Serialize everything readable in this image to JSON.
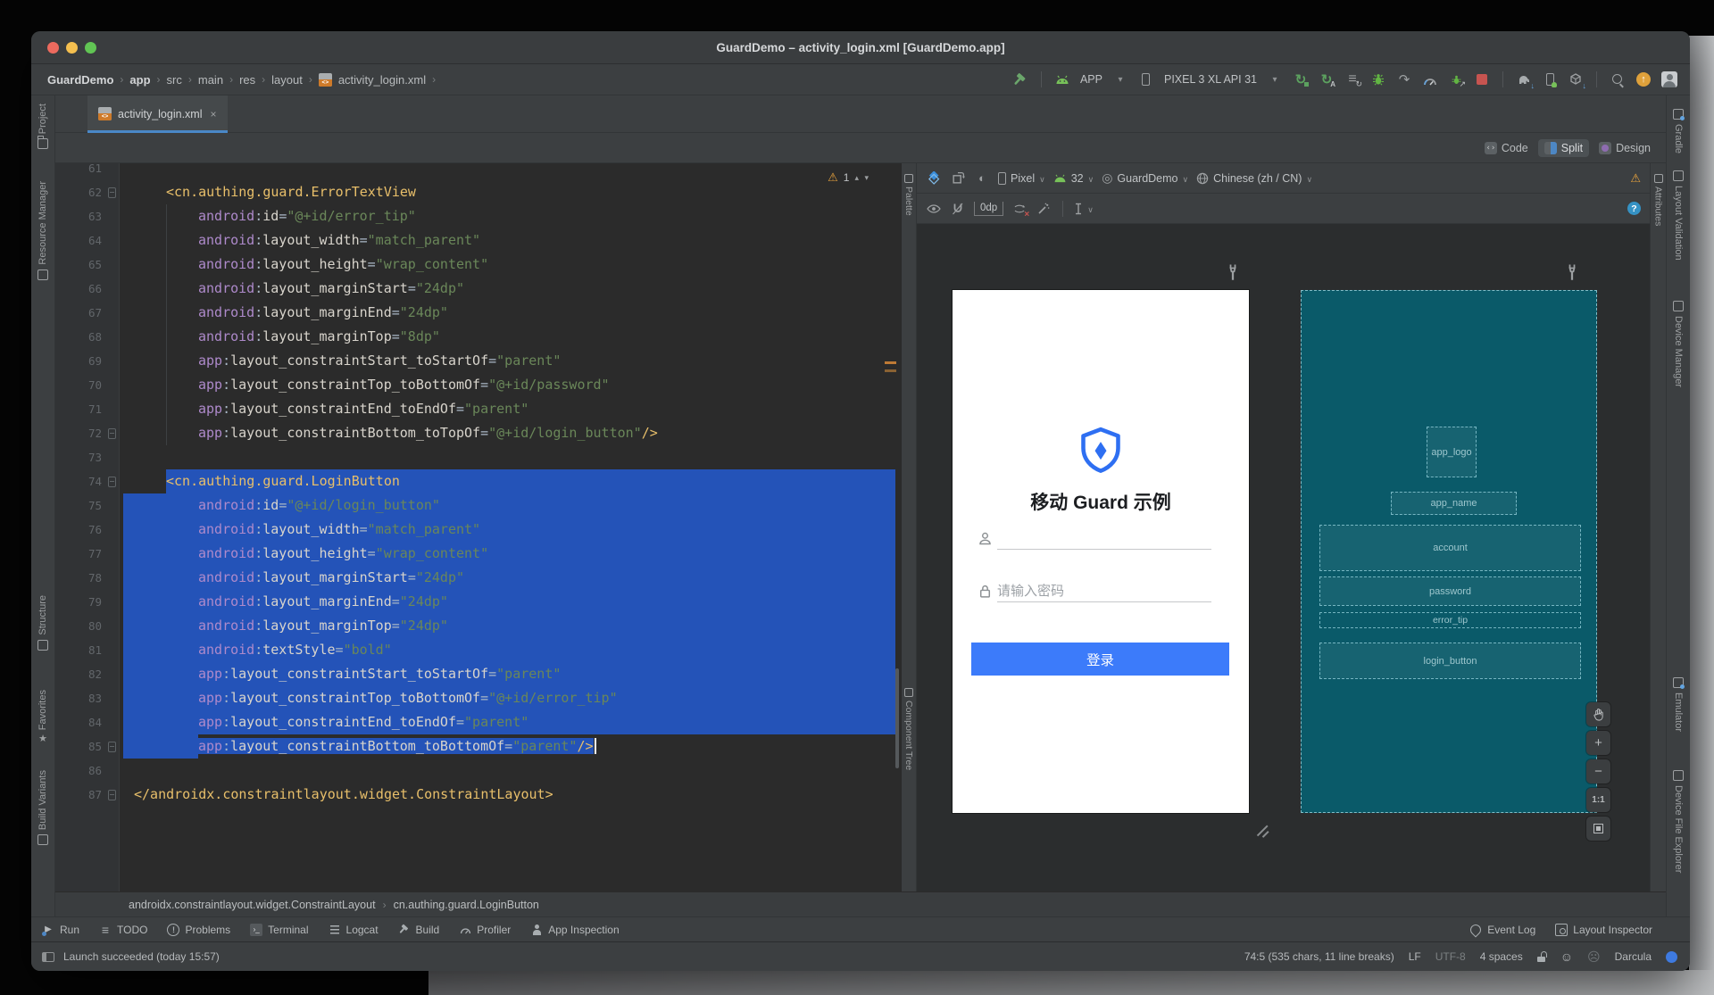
{
  "window": {
    "title": "GuardDemo – activity_login.xml [GuardDemo.app]"
  },
  "nav": {
    "breadcrumbs": [
      "GuardDemo",
      "app",
      "src",
      "main",
      "res",
      "layout",
      "activity_login.xml"
    ]
  },
  "run": {
    "config": "APP",
    "device": "PIXEL 3 XL API 31"
  },
  "tabs": {
    "active": "activity_login.xml",
    "close": "×"
  },
  "view": {
    "code": "Code",
    "split": "Split",
    "design": "Design"
  },
  "stripes": {
    "left": [
      "Project",
      "Resource Manager",
      "Structure",
      "Favorites",
      "Build Variants"
    ],
    "right": [
      "Gradle",
      "Layout Validation",
      "Device Manager",
      "Emulator",
      "Device File Explorer"
    ]
  },
  "editor": {
    "warning_count": "1",
    "lines": [
      {
        "n": 61,
        "i": 0,
        "tok": []
      },
      {
        "n": 62,
        "i": 4,
        "fold": 1,
        "tok": [
          [
            "t",
            "<cn.authing.guard.ErrorTextView"
          ]
        ]
      },
      {
        "n": 63,
        "i": 8,
        "tok": [
          [
            "n",
            "android"
          ],
          [
            "p",
            ":"
          ],
          [
            "a",
            "id"
          ],
          [
            "p",
            "="
          ],
          [
            "v",
            "\"@+id/error_tip\""
          ]
        ]
      },
      {
        "n": 64,
        "i": 8,
        "tok": [
          [
            "n",
            "android"
          ],
          [
            "p",
            ":"
          ],
          [
            "a",
            "layout_width"
          ],
          [
            "p",
            "="
          ],
          [
            "v",
            "\"match_parent\""
          ]
        ]
      },
      {
        "n": 65,
        "i": 8,
        "tok": [
          [
            "n",
            "android"
          ],
          [
            "p",
            ":"
          ],
          [
            "a",
            "layout_height"
          ],
          [
            "p",
            "="
          ],
          [
            "v",
            "\"wrap_content\""
          ]
        ]
      },
      {
        "n": 66,
        "i": 8,
        "tok": [
          [
            "n",
            "android"
          ],
          [
            "p",
            ":"
          ],
          [
            "a",
            "layout_marginStart"
          ],
          [
            "p",
            "="
          ],
          [
            "v",
            "\"24dp\""
          ]
        ]
      },
      {
        "n": 67,
        "i": 8,
        "tok": [
          [
            "n",
            "android"
          ],
          [
            "p",
            ":"
          ],
          [
            "a",
            "layout_marginEnd"
          ],
          [
            "p",
            "="
          ],
          [
            "v",
            "\"24dp\""
          ]
        ]
      },
      {
        "n": 68,
        "i": 8,
        "tok": [
          [
            "n",
            "android"
          ],
          [
            "p",
            ":"
          ],
          [
            "a",
            "layout_marginTop"
          ],
          [
            "p",
            "="
          ],
          [
            "v",
            "\"8dp\""
          ]
        ]
      },
      {
        "n": 69,
        "i": 8,
        "tok": [
          [
            "n",
            "app"
          ],
          [
            "p",
            ":"
          ],
          [
            "a",
            "layout_constraintStart_toStartOf"
          ],
          [
            "p",
            "="
          ],
          [
            "v",
            "\"parent\""
          ]
        ]
      },
      {
        "n": 70,
        "i": 8,
        "tok": [
          [
            "n",
            "app"
          ],
          [
            "p",
            ":"
          ],
          [
            "a",
            "layout_constraintTop_toBottomOf"
          ],
          [
            "p",
            "="
          ],
          [
            "v",
            "\"@+id/password\""
          ]
        ]
      },
      {
        "n": 71,
        "i": 8,
        "tok": [
          [
            "n",
            "app"
          ],
          [
            "p",
            ":"
          ],
          [
            "a",
            "layout_constraintEnd_toEndOf"
          ],
          [
            "p",
            "="
          ],
          [
            "v",
            "\"parent\""
          ]
        ]
      },
      {
        "n": 72,
        "i": 8,
        "fold": 1,
        "tok": [
          [
            "n",
            "app"
          ],
          [
            "p",
            ":"
          ],
          [
            "a",
            "layout_constraintBottom_toTopOf"
          ],
          [
            "p",
            "="
          ],
          [
            "v",
            "\"@+id/login_button\""
          ],
          [
            "t",
            "/>"
          ]
        ]
      },
      {
        "n": 73,
        "i": 0,
        "tok": []
      },
      {
        "n": 74,
        "i": 4,
        "fold": 1,
        "sel": "start",
        "tok": [
          [
            "t",
            "<cn.authing.guard.LoginButton"
          ]
        ]
      },
      {
        "n": 75,
        "i": 8,
        "sel": "full",
        "tok": [
          [
            "n",
            "android"
          ],
          [
            "p",
            ":"
          ],
          [
            "a",
            "id"
          ],
          [
            "p",
            "="
          ],
          [
            "v",
            "\"@+id/login_button\""
          ]
        ]
      },
      {
        "n": 76,
        "i": 8,
        "sel": "full",
        "tok": [
          [
            "n",
            "android"
          ],
          [
            "p",
            ":"
          ],
          [
            "a",
            "layout_width"
          ],
          [
            "p",
            "="
          ],
          [
            "v",
            "\"match_parent\""
          ]
        ]
      },
      {
        "n": 77,
        "i": 8,
        "sel": "full",
        "tok": [
          [
            "n",
            "android"
          ],
          [
            "p",
            ":"
          ],
          [
            "a",
            "layout_height"
          ],
          [
            "p",
            "="
          ],
          [
            "v",
            "\"wrap_content\""
          ]
        ]
      },
      {
        "n": 78,
        "i": 8,
        "sel": "full",
        "tok": [
          [
            "n",
            "android"
          ],
          [
            "p",
            ":"
          ],
          [
            "a",
            "layout_marginStart"
          ],
          [
            "p",
            "="
          ],
          [
            "v",
            "\"24dp\""
          ]
        ]
      },
      {
        "n": 79,
        "i": 8,
        "sel": "full",
        "tok": [
          [
            "n",
            "android"
          ],
          [
            "p",
            ":"
          ],
          [
            "a",
            "layout_marginEnd"
          ],
          [
            "p",
            "="
          ],
          [
            "v",
            "\"24dp\""
          ]
        ]
      },
      {
        "n": 80,
        "i": 8,
        "sel": "full",
        "tok": [
          [
            "n",
            "android"
          ],
          [
            "p",
            ":"
          ],
          [
            "a",
            "layout_marginTop"
          ],
          [
            "p",
            "="
          ],
          [
            "v",
            "\"24dp\""
          ]
        ]
      },
      {
        "n": 81,
        "i": 8,
        "sel": "full",
        "tok": [
          [
            "n",
            "android"
          ],
          [
            "p",
            ":"
          ],
          [
            "a",
            "textStyle"
          ],
          [
            "p",
            "="
          ],
          [
            "v",
            "\"bold\""
          ]
        ]
      },
      {
        "n": 82,
        "i": 8,
        "sel": "full",
        "tok": [
          [
            "n",
            "app"
          ],
          [
            "p",
            ":"
          ],
          [
            "a",
            "layout_constraintStart_toStartOf"
          ],
          [
            "p",
            "="
          ],
          [
            "v",
            "\"parent\""
          ]
        ]
      },
      {
        "n": 83,
        "i": 8,
        "sel": "full",
        "tok": [
          [
            "n",
            "app"
          ],
          [
            "p",
            ":"
          ],
          [
            "a",
            "layout_constraintTop_toBottomOf"
          ],
          [
            "p",
            "="
          ],
          [
            "v",
            "\"@+id/error_tip\""
          ]
        ]
      },
      {
        "n": 84,
        "i": 8,
        "sel": "full",
        "tok": [
          [
            "n",
            "app"
          ],
          [
            "p",
            ":"
          ],
          [
            "a",
            "layout_constraintEnd_toEndOf"
          ],
          [
            "p",
            "="
          ],
          [
            "v",
            "\"parent\""
          ]
        ]
      },
      {
        "n": 85,
        "i": 8,
        "fold": 1,
        "sel": "end",
        "caret": 1,
        "tok": [
          [
            "n",
            "app"
          ],
          [
            "p",
            ":"
          ],
          [
            "a",
            "layout_constraintBottom_toBottomOf"
          ],
          [
            "p",
            "="
          ],
          [
            "v",
            "\"parent\""
          ],
          [
            "t",
            "/>"
          ]
        ]
      },
      {
        "n": 86,
        "i": 0,
        "tok": []
      },
      {
        "n": 87,
        "i": 0,
        "fold": 1,
        "tok": [
          [
            "t",
            "</androidx.constraintlayout.widget.ConstraintLayout>"
          ]
        ]
      }
    ]
  },
  "design": {
    "device": "Pixel",
    "api": "32",
    "theme": "GuardDemo",
    "locale": "Chinese (zh / CN)",
    "margin": "0dp",
    "help": "?",
    "palette": "Palette",
    "component_tree": "Component Tree",
    "attributes": "Attributes",
    "zoom_in": "+",
    "zoom_out": "−",
    "zoom_ratio": "1:1",
    "preview": {
      "title": "移动 Guard 示例",
      "password_placeholder": "请输入密码",
      "login": "登录"
    },
    "blueprint": [
      "app_logo",
      "app_name",
      "account",
      "password",
      "error_tip",
      "login_button"
    ]
  },
  "xmlcrumb": [
    "androidx.constraintlayout.widget.ConstraintLayout",
    "cn.authing.guard.LoginButton"
  ],
  "tools": {
    "left": [
      "Run",
      "TODO",
      "Problems",
      "Terminal",
      "Logcat",
      "Build",
      "Profiler",
      "App Inspection"
    ],
    "right": [
      "Event Log",
      "Layout Inspector"
    ]
  },
  "status": {
    "left": "Launch succeeded (today 15:57)",
    "caret": "74:5 (535 chars, 11 line breaks)",
    "line_ending": "LF",
    "encoding": "UTF-8",
    "indent": "4 spaces",
    "theme": "Darcula"
  }
}
